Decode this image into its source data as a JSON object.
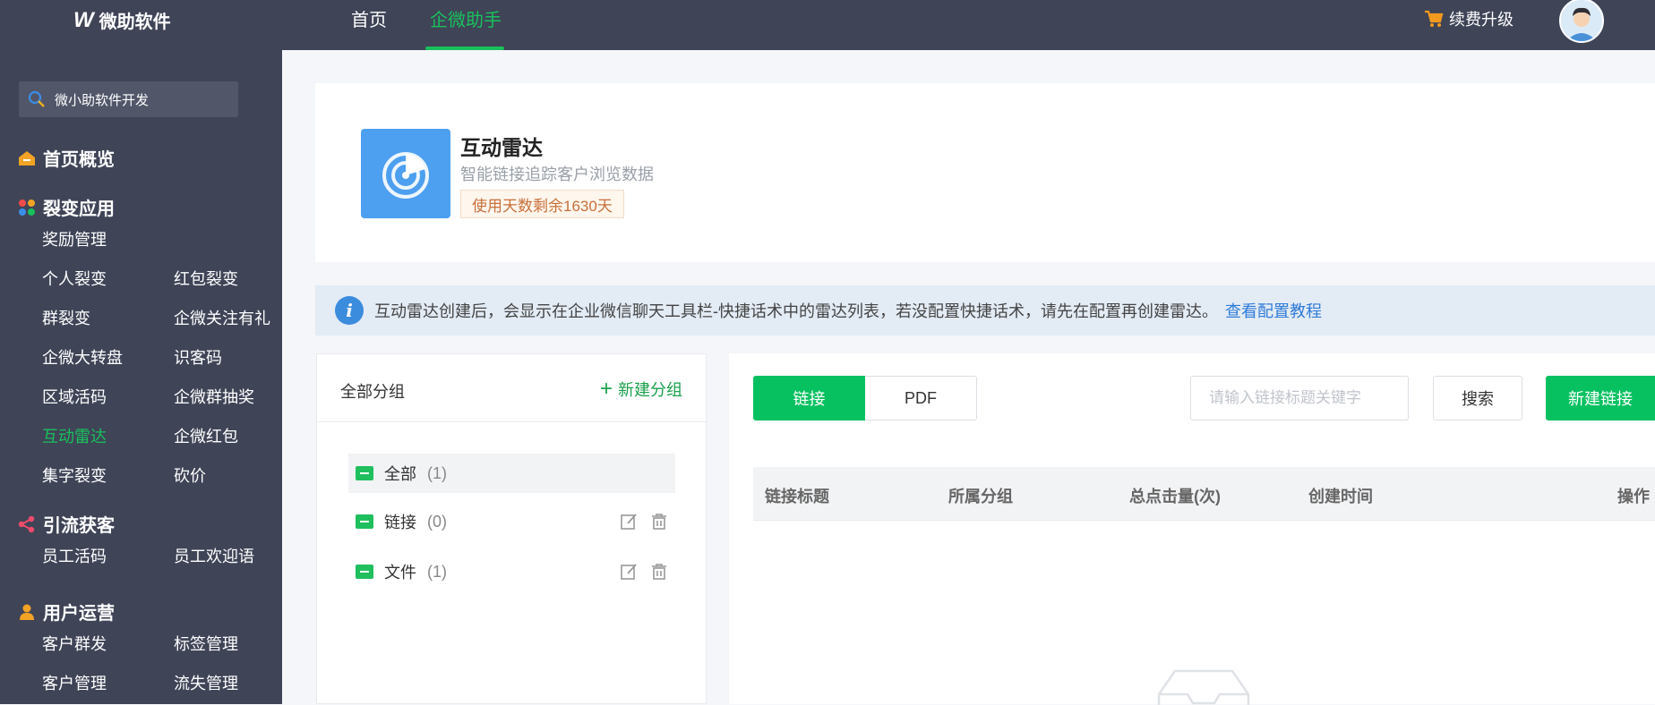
{
  "header": {
    "brand": "微助软件",
    "nav": [
      "首页",
      "企微助手"
    ],
    "active_nav": 1,
    "upgrade_label": "续费升级",
    "accent_color": "#19c05c"
  },
  "sidebar": {
    "search_text": "微小助软件开发",
    "sections": [
      {
        "title": "首页概览",
        "icon": "home-icon",
        "items": []
      },
      {
        "title": "裂变应用",
        "icon": "apps-icon",
        "items": [
          "奖励管理",
          "个人裂变",
          "红包裂变",
          "群裂变",
          "企微关注有礼",
          "企微大转盘",
          "识客码",
          "区域活码",
          "企微群抽奖",
          "互动雷达",
          "企微红包",
          "集字裂变",
          "砍价"
        ]
      },
      {
        "title": "引流获客",
        "icon": "share-icon",
        "items": [
          "员工活码",
          "员工欢迎语"
        ]
      },
      {
        "title": "用户运营",
        "icon": "user-icon",
        "items": [
          "客户群发",
          "标签管理",
          "客户管理",
          "流失管理"
        ]
      }
    ],
    "active_item": "互动雷达"
  },
  "app_card": {
    "title": "互动雷达",
    "subtitle": "智能链接追踪客户浏览数据",
    "days_badge": "使用天数剩余1630天",
    "icon": "radar-icon"
  },
  "notice": {
    "text": "互动雷达创建后，会显示在企业微信聊天工具栏-快捷话术中的雷达列表，若没配置快捷话术，请先在配置再创建雷达。",
    "link": "查看配置教程"
  },
  "groups": {
    "title": "全部分组",
    "new_group_label": "新建分组",
    "items": [
      {
        "name": "全部",
        "count": "(1)"
      },
      {
        "name": "链接",
        "count": "(0)"
      },
      {
        "name": "文件",
        "count": "(1)"
      }
    ]
  },
  "list": {
    "tabs": [
      "链接",
      "PDF"
    ],
    "active_tab": 0,
    "search_placeholder": "请输入链接标题关键字",
    "search_button": "搜索",
    "new_button": "新建链接",
    "columns": [
      "链接标题",
      "所属分组",
      "总点击量(次)",
      "创建时间",
      "操作"
    ],
    "rows": []
  }
}
